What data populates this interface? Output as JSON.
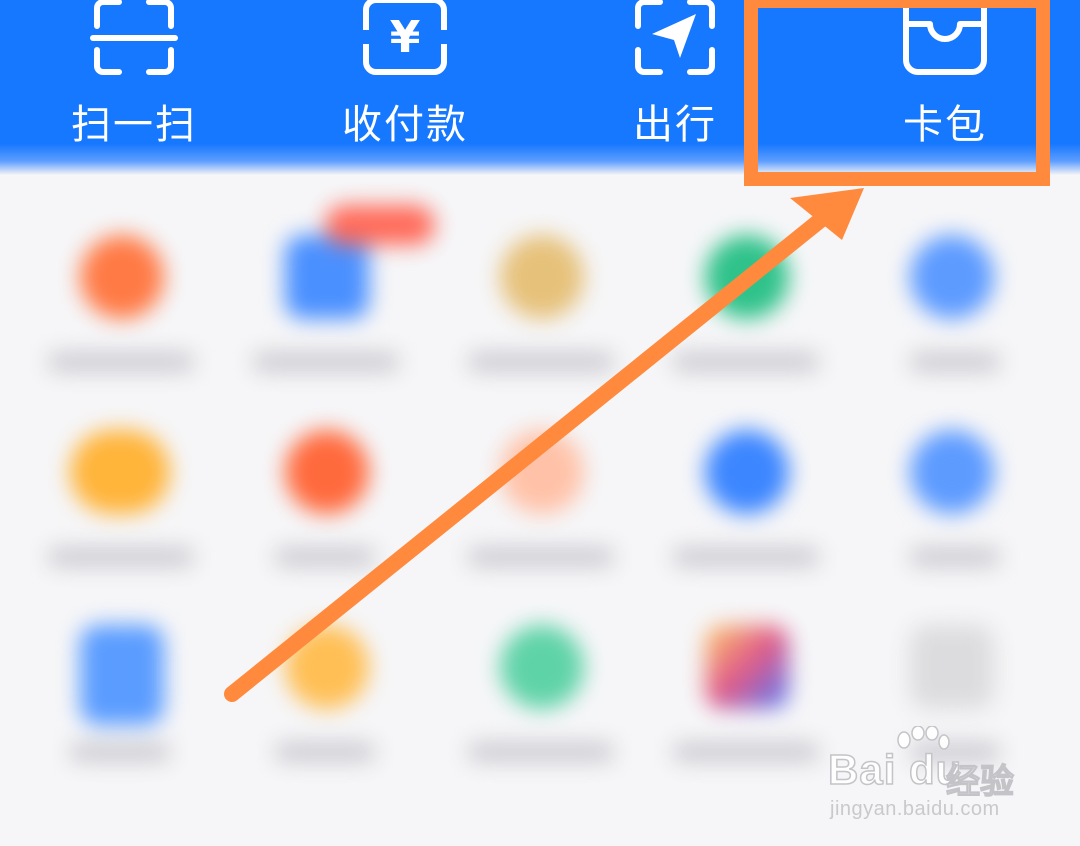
{
  "quick_actions": [
    {
      "label": "扫一扫",
      "icon": "scan-icon"
    },
    {
      "label": "收付款",
      "icon": "yuan-payment-icon"
    },
    {
      "label": "出行",
      "icon": "travel-navigation-icon"
    },
    {
      "label": "卡包",
      "icon": "card-wallet-icon"
    }
  ],
  "icon_glyphs": {
    "yuan": "¥"
  },
  "colors": {
    "header_blue": "#1677ff",
    "annotation_orange": "#ff8a3d",
    "background": "#f6f6f8"
  },
  "app_grid": {
    "note_blurred": true,
    "rows": [
      [
        {
          "color": "#ff7a45",
          "shape": "round"
        },
        {
          "color": "#4a90ff",
          "shape": "square",
          "badge": true
        },
        {
          "color": "#e6c17a",
          "shape": "round"
        },
        {
          "color": "#2fc28a",
          "shape": "round"
        },
        {
          "color": "#5d9bff",
          "shape": "round"
        }
      ],
      [
        {
          "color": "#ffb43a",
          "shape": "round"
        },
        {
          "color": "#ff6a3d",
          "shape": "round"
        },
        {
          "color": "#ffc2a8",
          "shape": "round"
        },
        {
          "color": "#3c86ff",
          "shape": "round"
        },
        {
          "color": "#5d9bff",
          "shape": "round"
        }
      ],
      [
        {
          "color": "#5a9cff",
          "shape": "square"
        },
        {
          "color": "#ffbf55",
          "shape": "round"
        },
        {
          "color": "#5fd3a8",
          "shape": "round"
        },
        {
          "color": "#e07a7a",
          "shape": "square"
        },
        {
          "color": "#dcdcde",
          "shape": "square"
        }
      ]
    ]
  },
  "watermark": {
    "brand": "Bai du",
    "brand_cn": "经验",
    "url": "jingyan.baidu.com"
  }
}
